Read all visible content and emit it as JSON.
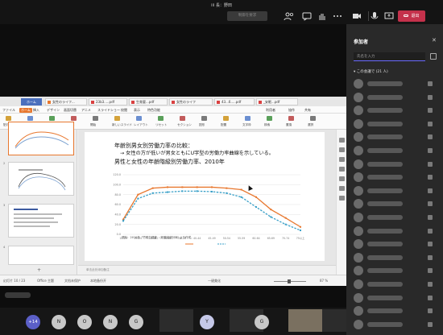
{
  "meeting": {
    "title": "iii 長：野田",
    "stop_presenting_label": "制御を要求",
    "leave_label": "退出"
  },
  "wps": {
    "home_tab": "ホーム",
    "doc_tabs": [
      {
        "label": "女性のライフ...",
        "color": "#e8772e"
      },
      {
        "label": "23b3.....pdf",
        "color": "#d94141"
      },
      {
        "label": "生育要...pdf",
        "color": "#d94141"
      },
      {
        "label": "女性のライフ",
        "color": "#d94141"
      },
      {
        "label": "43...6.....pdf",
        "color": "#d94141"
      },
      {
        "label": "_安眠...pdf",
        "color": "#d94141"
      }
    ],
    "menu": [
      "ファイル",
      "ホーム",
      "挿入",
      "デザイン",
      "画面切替",
      "アニメ",
      "スライドショー",
      "校閲",
      "表示",
      "特色功能"
    ],
    "menu_active_index": 1,
    "menu_right": [
      "利用者",
      "協作",
      "共有"
    ],
    "ribbon_labels": [
      "貼付",
      "切取",
      "複製",
      "書式",
      "開始",
      "新しいスライド",
      "レイアウト",
      "リセット",
      "セクション",
      "図形",
      "配置",
      "文字枠",
      "検索",
      "置換",
      "選択"
    ],
    "outline_tab": "大綱",
    "slide_tab": "幻灯片",
    "thumb_numbers": [
      "2",
      "3",
      "4",
      "5"
    ],
    "add_slide": "+",
    "notes_placeholder": "单击此处添加备注",
    "status": {
      "slide_no": "幻灯片 10 / 23",
      "theme": "Office 主题",
      "protect": "文档未保护",
      "backup": "本地备份开",
      "layout": "一键美化",
      "zoom": "87 %"
    }
  },
  "slide": {
    "title": "年齢別男女別労働力率の比較：",
    "bullet": "→ 女性の方が低いが男女ともにU字型の労働力率曲線を示している。",
    "chart_title": "男性と女性の年齢階級別労働力率、2010年",
    "source_note": "資料：2010年「労働力調査」(総務省統計局) より作成。"
  },
  "chart_data": {
    "type": "line",
    "title": "男性と女性の年齢階級別労働力率、2010年",
    "categories": [
      "15-19",
      "20-24",
      "25-29",
      "30-34",
      "35-39",
      "40-44",
      "45-49",
      "50-54",
      "55-59",
      "60-64",
      "65-69",
      "70-74",
      "75以上"
    ],
    "ylim": [
      0,
      120
    ],
    "yticks": [
      "0.0",
      "20.0",
      "40.0",
      "60.0",
      "80.0",
      "100.0",
      "120.0"
    ],
    "series": [
      {
        "color": "#e8772e",
        "values": [
          30,
          80,
          93,
          95,
          95,
          95,
          95,
          93,
          90,
          75,
          50,
          33,
          15
        ]
      },
      {
        "color": "#3aa0c8",
        "values": [
          27,
          72,
          83,
          85,
          87,
          87,
          86,
          83,
          75,
          55,
          35,
          20,
          8
        ]
      }
    ],
    "legend_position": "bottom",
    "grid": true
  },
  "participants": {
    "title": "参加者",
    "search_placeholder": "氏名を入力",
    "section_label": "この会議で (21 人)",
    "rows_visible": 19
  },
  "bottom": {
    "overflow_count": "+14",
    "avatars": [
      "N",
      "O",
      "N",
      "G",
      "Y",
      "G"
    ]
  }
}
